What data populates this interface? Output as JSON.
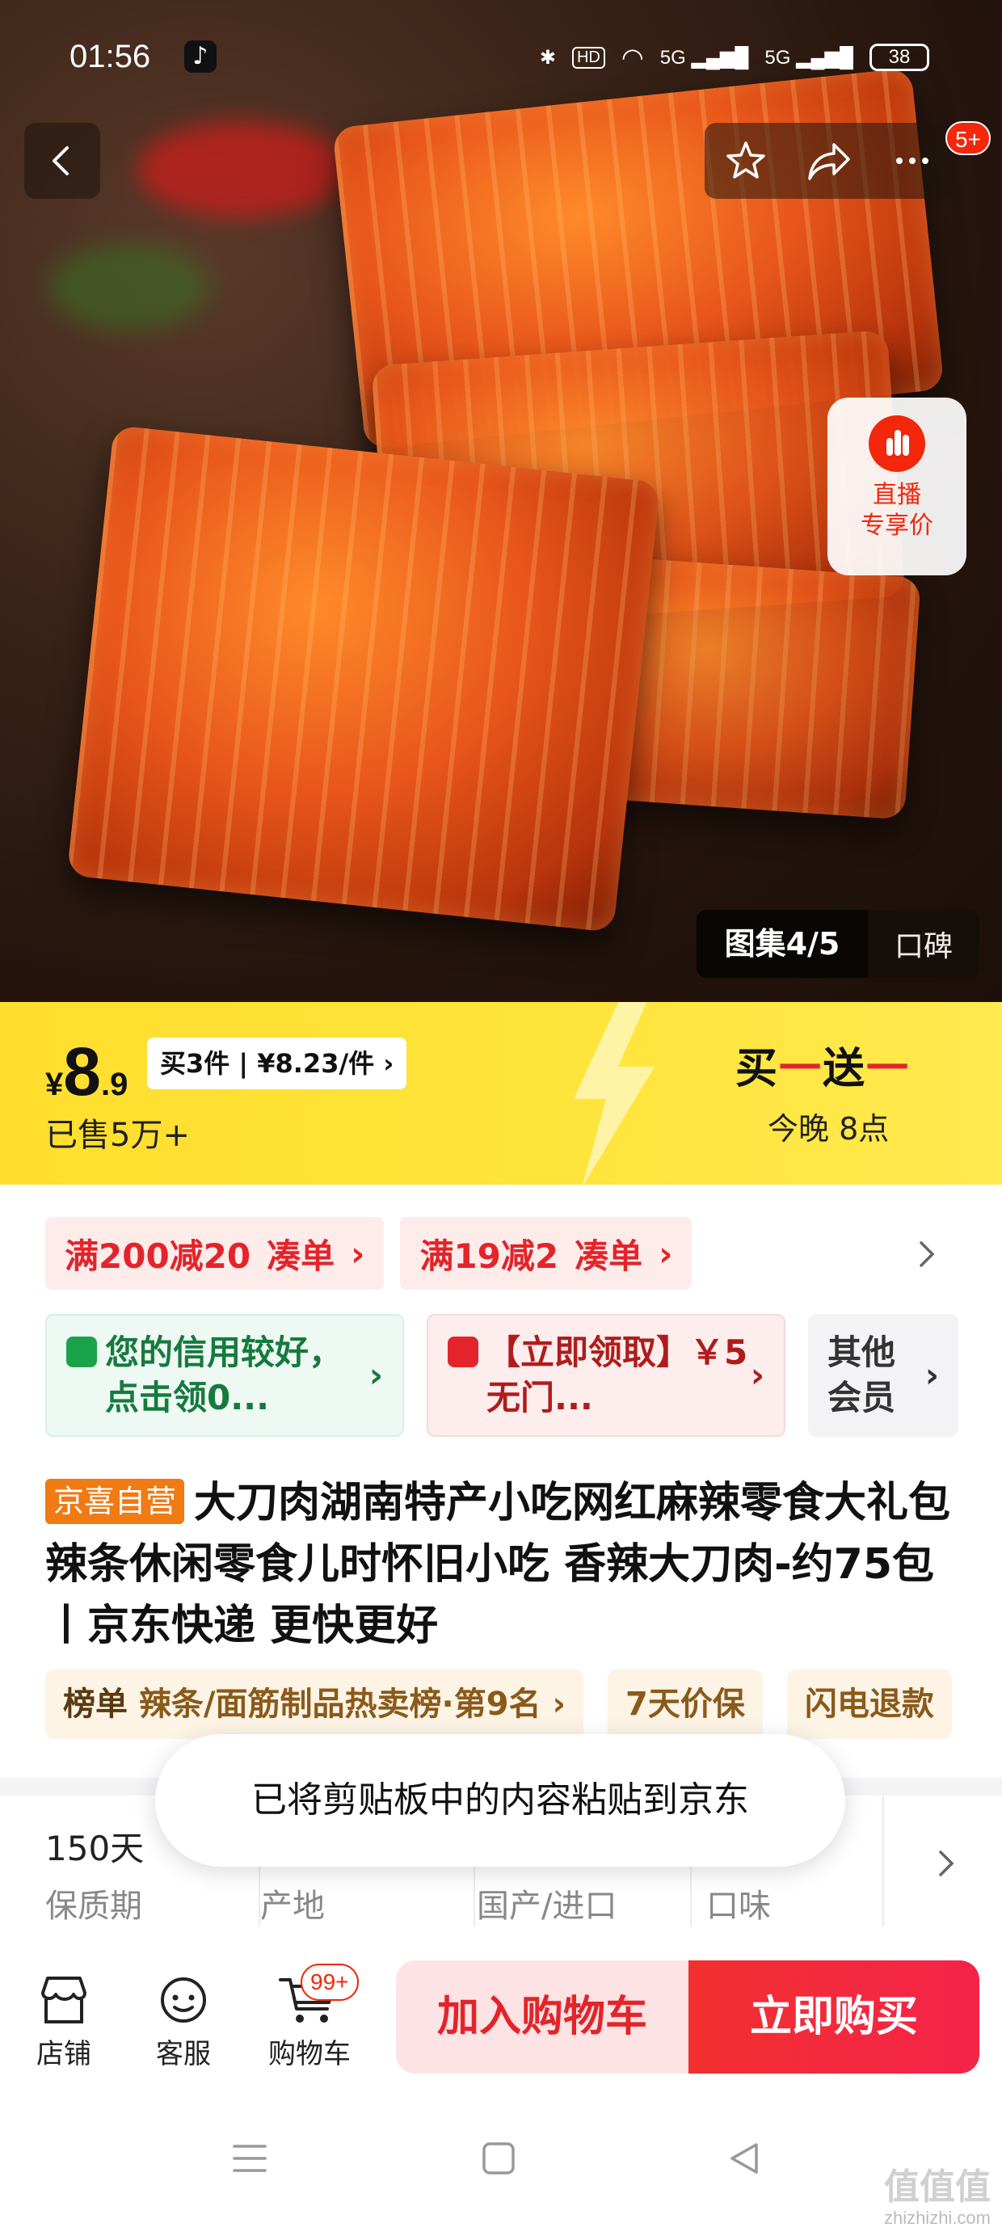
{
  "status_bar": {
    "time": "01:56",
    "indicators": [
      "bluetooth-icon",
      "HD",
      "wifi-icon",
      "5G",
      "5G"
    ],
    "hd_label": "HD",
    "net1": "5G",
    "net2": "5G",
    "battery": "38"
  },
  "header": {
    "badge": "5+",
    "back_icon": "chevron-left-icon",
    "star_icon": "star-icon",
    "share_icon": "share-icon",
    "more_icon": "more-icon"
  },
  "live_card": {
    "line1": "直播",
    "line2": "专享价"
  },
  "gallery": {
    "label": "图集4/5",
    "reviews": "口碑"
  },
  "price": {
    "yen": "¥",
    "integer": "8",
    "decimal": ".9",
    "bulk": "买3件 | ¥8.23/件",
    "sold": "已售5万+",
    "promo_a": "买",
    "promo_dash1": "一",
    "promo_b": "送",
    "promo_dash2": "一",
    "promo_time": "今晚 8点",
    "accent": "#ffde2e"
  },
  "coupons": [
    {
      "amount": "满200减20",
      "action": "凑单"
    },
    {
      "amount": "满19减2",
      "action": "凑单"
    }
  ],
  "benefits": {
    "credit": "您的信用较好，点击领0...",
    "coupon": "【立即领取】￥5 无门...",
    "member": "其他会员"
  },
  "title": {
    "tag": "京喜自营",
    "text": "大刀肉湖南特产小吃网红麻辣零食大礼包辣条休闲零食儿时怀旧小吃 香辣大刀肉-约75包丨京东快递 更快更好"
  },
  "ranks": {
    "rank_label": "榜单",
    "rank_text": "辣条/面筋制品热卖榜·第9名",
    "price_protect": "7天价保",
    "refund": "闪电退款"
  },
  "specs": [
    {
      "value": "150天",
      "label": "保质期"
    },
    {
      "value": "",
      "label": "产地"
    },
    {
      "value": "",
      "label": "国产/进口"
    },
    {
      "value": "",
      "label": "口味"
    }
  ],
  "toast": "已将剪贴板中的内容粘贴到京东",
  "bottom_nav": {
    "store": "店铺",
    "service": "客服",
    "cart": "购物车",
    "cart_badge": "99+",
    "add_cart": "加入购物车",
    "buy_now": "立即购买"
  },
  "watermark": {
    "big": "值值值",
    "small": "zhizhizhi.com"
  }
}
